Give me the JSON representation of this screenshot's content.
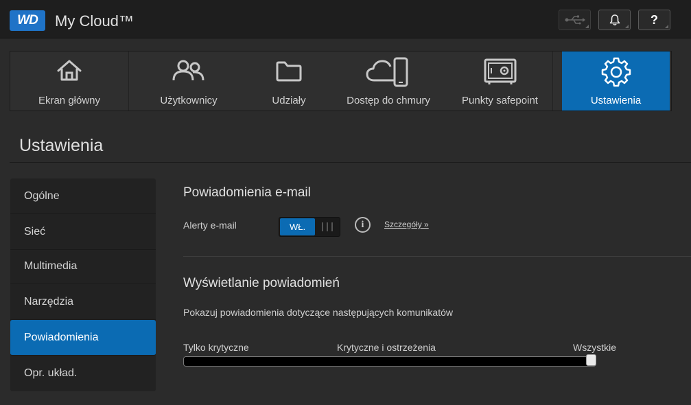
{
  "header": {
    "logo_text": "WD",
    "app_title": "My Cloud™"
  },
  "top_buttons": {
    "help_label": "?"
  },
  "nav": [
    {
      "label": "Ekran główny",
      "icon": "home-icon"
    },
    {
      "label": "Użytkownicy",
      "icon": "users-icon"
    },
    {
      "label": "Udziały",
      "icon": "folder-icon"
    },
    {
      "label": "Dostęp do chmury",
      "icon": "cloud-phone-icon"
    },
    {
      "label": "Punkty safepoint",
      "icon": "safe-icon"
    },
    {
      "label": "Ustawienia",
      "icon": "gear-icon",
      "active": true
    }
  ],
  "page_title": "Ustawienia",
  "sidebar": {
    "items": [
      {
        "label": "Ogólne"
      },
      {
        "label": "Sieć"
      },
      {
        "label": "Multimedia"
      },
      {
        "label": "Narzędzia"
      },
      {
        "label": "Powiadomienia",
        "active": true
      },
      {
        "label": "Opr. układ."
      }
    ]
  },
  "email_section": {
    "title": "Powiadomienia e-mail",
    "alert_label": "Alerty e-mail",
    "toggle_on_label": "WŁ.",
    "toggle_state": "on",
    "details_link": "Szczegóły »"
  },
  "display_section": {
    "title": "Wyświetlanie powiadomień",
    "description": "Pokazuj powiadomienia dotyczące następujących komunikatów",
    "slider_labels": [
      "Tylko krytyczne",
      "Krytyczne i ostrzeżenia",
      "Wszystkie"
    ],
    "slider_value": "Wszystkie"
  },
  "colors": {
    "accent": "#0b6bb3",
    "background": "#2b2b2b",
    "topbar": "#1e1e1e"
  }
}
